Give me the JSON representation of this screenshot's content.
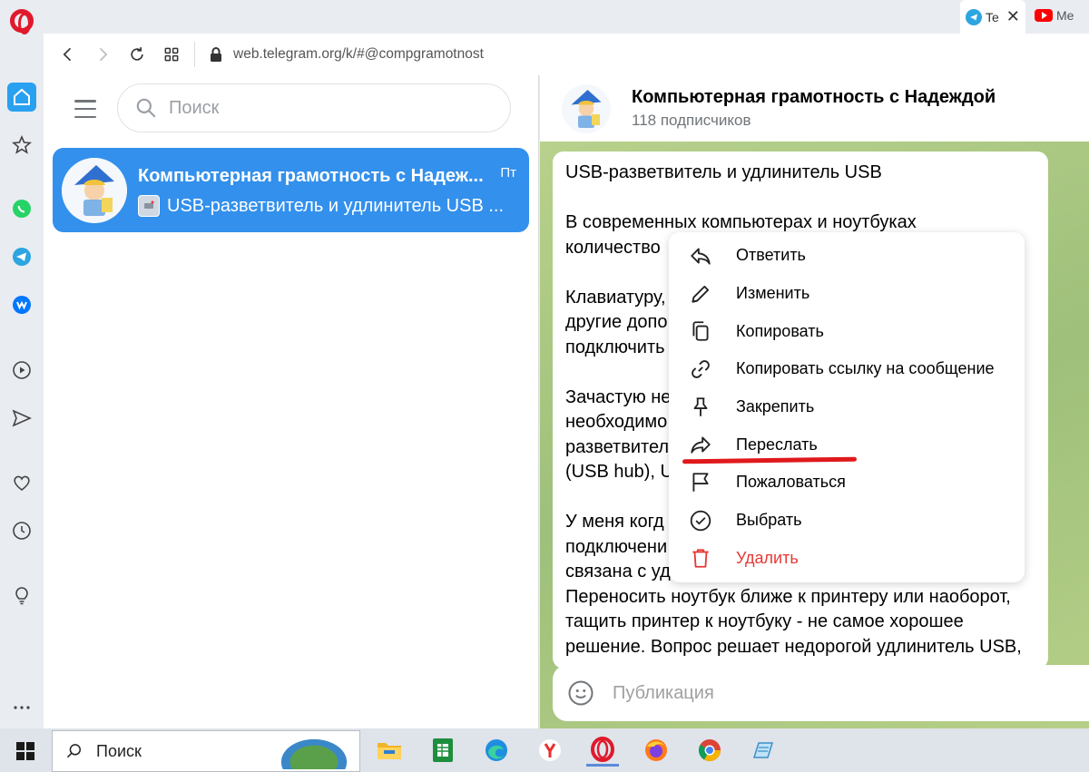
{
  "browser": {
    "tabs": [
      {
        "label": "Te",
        "active": true
      },
      {
        "label": "Me",
        "active": false
      }
    ],
    "url": "web.telegram.org/k/#@compgramotnost"
  },
  "sidebar_left": {
    "search_placeholder": "Поиск",
    "chat": {
      "title": "Компьютерная грамотность с Надеж...",
      "time": "Пт",
      "preview": "USB-разветвитель и удлинитель USB ..."
    }
  },
  "chat_header": {
    "title": "Компьютерная грамотность с Надеждой",
    "subscribers": "118 подписчиков"
  },
  "message": {
    "title": "USB-разветвитель и удлинитель USB",
    "p1": [
      "В современных компьютерах и ноутбуках",
      "количество"
    ],
    "p2": [
      "Клавиатуру,",
      "другие допо",
      "подключить"
    ],
    "p3": [
      "Зачастую не",
      "необходимо",
      "разветвител",
      "(USB hub), U"
    ],
    "p4": [
      "У меня когд",
      "подключени",
      "связана с уд",
      "Переносить ноутбук ближе к принтеру или наоборот,",
      "тащить принтер к ноутбуку - не самое хорошее",
      "решение. Вопрос решает недорогой удлинитель USB,"
    ]
  },
  "composer": {
    "placeholder": "Публикация"
  },
  "context_menu": {
    "items": [
      {
        "label": "Ответить",
        "icon": "reply-icon"
      },
      {
        "label": "Изменить",
        "icon": "pencil-icon"
      },
      {
        "label": "Копировать",
        "icon": "copy-icon"
      },
      {
        "label": "Копировать ссылку на сообщение",
        "icon": "link-icon"
      },
      {
        "label": "Закрепить",
        "icon": "pin-icon"
      },
      {
        "label": "Переслать",
        "icon": "forward-icon",
        "highlighted": true
      },
      {
        "label": "Пожаловаться",
        "icon": "flag-icon"
      },
      {
        "label": "Выбрать",
        "icon": "check-circle-icon"
      },
      {
        "label": "Удалить",
        "icon": "trash-icon",
        "danger": true
      }
    ],
    "highlight_color": "#e0191c",
    "danger_color": "#e53935"
  },
  "taskbar": {
    "search_text": "Поиск",
    "apps": [
      "file-explorer-icon",
      "spreadsheet-icon",
      "edge-icon",
      "yandex-icon",
      "opera-icon",
      "firefox-icon",
      "chrome-icon",
      "notepad-icon"
    ]
  },
  "colors": {
    "telegram_blue": "#3390ec",
    "chat_bg": "#a9c77f",
    "opera_red": "#e0192c"
  }
}
